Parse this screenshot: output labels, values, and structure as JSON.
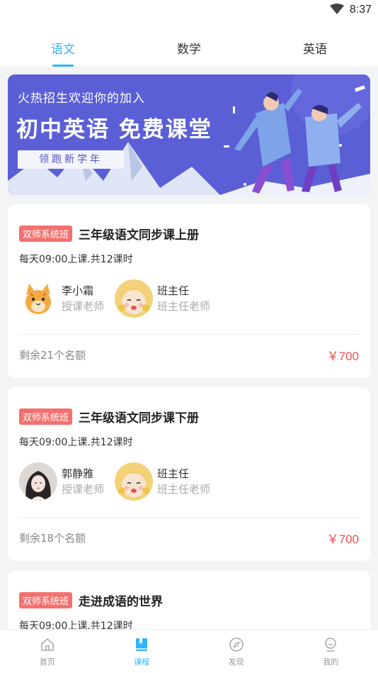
{
  "status": {
    "time": "8:37"
  },
  "tabs": [
    {
      "label": "语文",
      "active": true
    },
    {
      "label": "数学",
      "active": false
    },
    {
      "label": "英语",
      "active": false
    }
  ],
  "banner": {
    "subtitle": "火热招生欢迎你的加入",
    "headline": "初中英语 免费课堂",
    "tagline": "领跑新学年",
    "bg_color": "#5b5fd6"
  },
  "courses": [
    {
      "tag": "双师系统班",
      "title": "三年级语文同步课上册",
      "schedule": "每天09:00上课.共12课时",
      "teachers": [
        {
          "name": "李小霜",
          "role": "授课老师",
          "avatar": "cat-avatar"
        },
        {
          "name": "班主任",
          "role": "班主任老师",
          "avatar": "anime-girl-avatar"
        }
      ],
      "remaining": "剩余21个名额",
      "price": "￥700"
    },
    {
      "tag": "双师系统班",
      "title": "三年级语文同步课下册",
      "schedule": "每天09:00上课.共12课时",
      "teachers": [
        {
          "name": "郭静雅",
          "role": "授课老师",
          "avatar": "woman-avatar"
        },
        {
          "name": "班主任",
          "role": "班主任老师",
          "avatar": "anime-girl-avatar"
        }
      ],
      "remaining": "剩余18个名额",
      "price": "￥700"
    },
    {
      "tag": "双师系统班",
      "title": "走进成语的世界",
      "schedule": "每天09:00上课.共12课时"
    }
  ],
  "bottom_nav": [
    {
      "label": "首页",
      "icon": "home-icon",
      "active": false
    },
    {
      "label": "课程",
      "icon": "book-icon",
      "active": true
    },
    {
      "label": "发现",
      "icon": "compass-icon",
      "active": false
    },
    {
      "label": "我的",
      "icon": "profile-icon",
      "active": false
    }
  ],
  "colors": {
    "accent": "#2fb3ff",
    "tag": "#f2716f",
    "price": "#f24b4b"
  }
}
